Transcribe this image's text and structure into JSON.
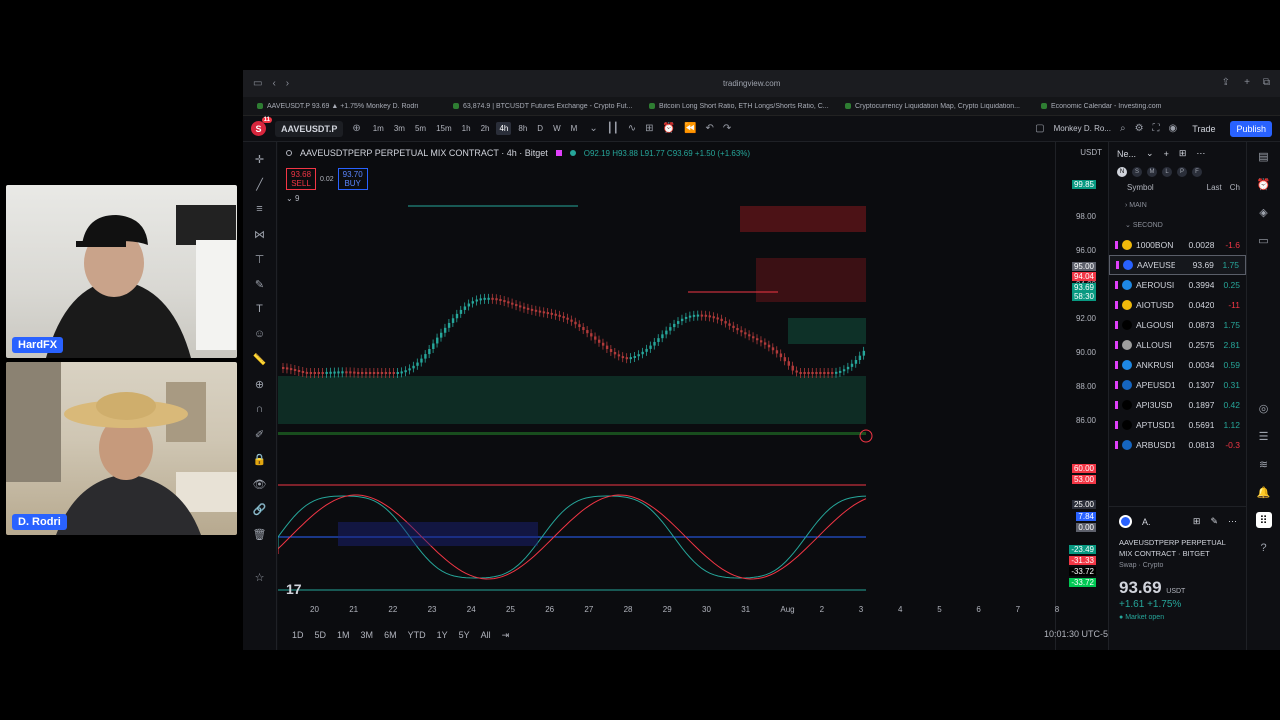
{
  "webcams": [
    {
      "label": "HardFX"
    },
    {
      "label": "D. Rodri"
    }
  ],
  "browser": {
    "url": "tradingview.com",
    "tabs": [
      "AAVEUSDT.P 93.69 ▲ +1.75% Monkey D. Rodri",
      "63,874.9 | BTCUSDT Futures Exchange - Crypto Fut...",
      "Bitcoin Long Short Ratio, ETH Longs/Shorts Ratio, C...",
      "Cryptocurrency Liquidation Map, Crypto Liquidation...",
      "Economic Calendar - Investing.com"
    ]
  },
  "toolbar": {
    "avatar": "S",
    "notifications": "11",
    "symbol": "AAVEUSDT.P",
    "timeframes": [
      "1m",
      "3m",
      "5m",
      "15m",
      "1h",
      "2h",
      "4h",
      "8h",
      "D",
      "W",
      "M"
    ],
    "active_timeframe": "4h",
    "username": "Monkey D. Ro...",
    "trade_label": "Trade",
    "publish_label": "Publish"
  },
  "chart": {
    "title": "AAVEUSDTPERP PERPETUAL MIX CONTRACT · 4h · Bitget",
    "ohlc": "O92.19 H93.88 L91.77 C93.69 +1.50 (+1.63%)",
    "sell_price": "93.68",
    "sell_label": "SELL",
    "spread": "0.02",
    "buy_price": "93.70",
    "buy_label": "BUY",
    "indicator_count": "9",
    "currency": "USDT",
    "price_labels": [
      "98.00",
      "96.00",
      "94.00",
      "92.00",
      "90.00",
      "88.00",
      "86.00"
    ],
    "price_tags": [
      {
        "text": "99.85",
        "color": "#089981"
      },
      {
        "text": "95.00",
        "color": "#5d606b"
      },
      {
        "text": "94.04",
        "color": "#f23645"
      },
      {
        "text": "93.69",
        "color": "#089981"
      },
      {
        "text": "58:30",
        "color": "#089981"
      }
    ],
    "osc_tags": [
      {
        "text": "60.00",
        "color": "#f23645"
      },
      {
        "text": "53.00",
        "color": "#f23645"
      },
      {
        "text": "25.00",
        "color": "#2a2e39"
      },
      {
        "text": "7.84",
        "color": "#2962ff"
      },
      {
        "text": "0.00",
        "color": "#5d606b"
      },
      {
        "text": "-23.49",
        "color": "#089981"
      },
      {
        "text": "-31.33",
        "color": "#f23645"
      },
      {
        "text": "-33.72",
        "color": "#000000"
      },
      {
        "text": "-33.72",
        "color": "#00c853"
      }
    ],
    "time_labels": [
      "20",
      "21",
      "22",
      "23",
      "24",
      "25",
      "26",
      "27",
      "28",
      "29",
      "30",
      "31",
      "Aug",
      "2",
      "3",
      "4",
      "5",
      "6",
      "7",
      "8"
    ],
    "ranges": [
      "1D",
      "5D",
      "1M",
      "3M",
      "6M",
      "YTD",
      "1Y",
      "5Y",
      "All"
    ],
    "clock": "10:01:30 UTC-5",
    "logo": "17"
  },
  "watchlist": {
    "title": "Ne...",
    "flags": [
      "N",
      "S",
      "M",
      "L",
      "P",
      "F"
    ],
    "col_symbol": "Symbol",
    "col_last": "Last",
    "col_change": "Ch",
    "sections": [
      "MAIN",
      "SECOND"
    ],
    "rows": [
      {
        "sym": "1000BON",
        "last": "0.0028",
        "chg": "-1.6",
        "dir": "neg",
        "color": "#f0b90b"
      },
      {
        "sym": "AAVEUSE",
        "last": "93.69",
        "chg": "1.75",
        "dir": "pos",
        "color": "#2962ff"
      },
      {
        "sym": "AEROUSI",
        "last": "0.3994",
        "chg": "0.25",
        "dir": "pos",
        "color": "#1e88e5"
      },
      {
        "sym": "AIOTUSD",
        "last": "0.0420",
        "chg": "-11",
        "dir": "neg",
        "color": "#f0b90b"
      },
      {
        "sym": "ALGOUSI",
        "last": "0.0873",
        "chg": "1.75",
        "dir": "pos",
        "color": "#000000"
      },
      {
        "sym": "ALLOUSI",
        "last": "0.2575",
        "chg": "2.81",
        "dir": "pos",
        "color": "#9e9e9e"
      },
      {
        "sym": "ANKRUSI",
        "last": "0.0034",
        "chg": "0.59",
        "dir": "pos",
        "color": "#1e88e5"
      },
      {
        "sym": "APEUSD1",
        "last": "0.1307",
        "chg": "0.31",
        "dir": "pos",
        "color": "#1565c0"
      },
      {
        "sym": "API3USD",
        "last": "0.1897",
        "chg": "0.42",
        "dir": "pos",
        "color": "#000000"
      },
      {
        "sym": "APTUSD1",
        "last": "0.5691",
        "chg": "1.12",
        "dir": "pos",
        "color": "#000000"
      },
      {
        "sym": "ARBUSD1",
        "last": "0.0813",
        "chg": "-0.3",
        "dir": "neg",
        "color": "#1565c0"
      }
    ],
    "detail": {
      "short": "A.",
      "name": "AAVEUSDTPERP PERPETUAL MIX CONTRACT",
      "exchange": "BITGET",
      "type": "Swap · Crypto",
      "price": "93.69",
      "currency": "USDT",
      "change": "+1.61 +1.75%",
      "status": "Market open"
    }
  }
}
